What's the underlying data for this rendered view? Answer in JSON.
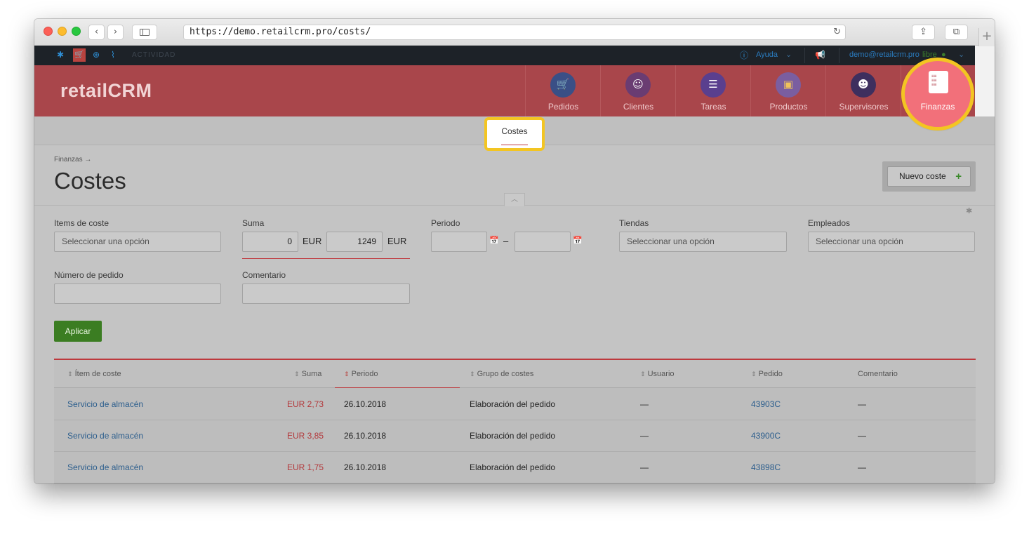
{
  "browser": {
    "url": "https://demo.retailcrm.pro/costs/",
    "back_glyph": "‹",
    "forward_glyph": "›",
    "reload_glyph": "↻",
    "share_glyph": "⇪",
    "tabs_glyph": "⧉",
    "newtab_glyph": "+"
  },
  "topbar": {
    "activity_label": "ACTIVIDAD",
    "help_label": "Ayuda",
    "user_email": "demo@retailcrm.pro",
    "user_status": "libre",
    "chevron": "⌄"
  },
  "header": {
    "logo": "retailCRM",
    "nav": [
      {
        "label": "Pedidos",
        "glyph": "🛒",
        "color": "#3a4f86"
      },
      {
        "label": "Clientes",
        "glyph": "☺",
        "color": "#6a3c72"
      },
      {
        "label": "Tareas",
        "glyph": "☰",
        "color": "#5a3f8e"
      },
      {
        "label": "Productos",
        "glyph": "▣",
        "color": "#7a5ea0"
      },
      {
        "label": "Supervisores",
        "glyph": "☻",
        "color": "#3e2f5e"
      }
    ],
    "active": {
      "label": "Finanzas",
      "doc_lines": "≡ ≡\n≡ ≡\n≡ ≡"
    }
  },
  "subnav": {
    "active_item": "Costes"
  },
  "page": {
    "breadcrumb": "Finanzas →",
    "title": "Costes",
    "new_button": "Nuevo coste",
    "new_button_plus": "+"
  },
  "filters": {
    "items_label": "Items de coste",
    "items_placeholder": "Seleccionar una opción",
    "suma_label": "Suma",
    "suma_min": "0",
    "suma_max": "1249",
    "currency": "EUR",
    "periodo_label": "Periodo",
    "periodo_dash": "–",
    "tiendas_label": "Tiendas",
    "tiendas_placeholder": "Seleccionar una opción",
    "empleados_label": "Empleados",
    "empleados_placeholder": "Seleccionar una opción",
    "pedido_label": "Número de pedido",
    "comentario_label": "Comentario",
    "apply_button": "Aplicar"
  },
  "table": {
    "sort_arrow": "⇕",
    "columns": {
      "item": "Ítem de coste",
      "suma": "Suma",
      "periodo": "Periodo",
      "grupo": "Grupo de costes",
      "usuario": "Usuario",
      "pedido": "Pedido",
      "comentario": "Comentario"
    },
    "rows": [
      {
        "item": "Servicio de almacén",
        "suma": "EUR 2,73",
        "periodo": "26.10.2018",
        "grupo": "Elaboración del pedido",
        "usuario": "—",
        "pedido": "43903C",
        "comentario": "—"
      },
      {
        "item": "Servicio de almacén",
        "suma": "EUR 3,85",
        "periodo": "26.10.2018",
        "grupo": "Elaboración del pedido",
        "usuario": "—",
        "pedido": "43900C",
        "comentario": "—"
      },
      {
        "item": "Servicio de almacén",
        "suma": "EUR 1,75",
        "periodo": "26.10.2018",
        "grupo": "Elaboración del pedido",
        "usuario": "—",
        "pedido": "43898C",
        "comentario": "—"
      }
    ]
  },
  "colors": {
    "brand_red": "#a9464b",
    "highlight_yellow": "#f3c522",
    "apply_green": "#3b7d22",
    "link_blue": "#2c5e8d"
  }
}
